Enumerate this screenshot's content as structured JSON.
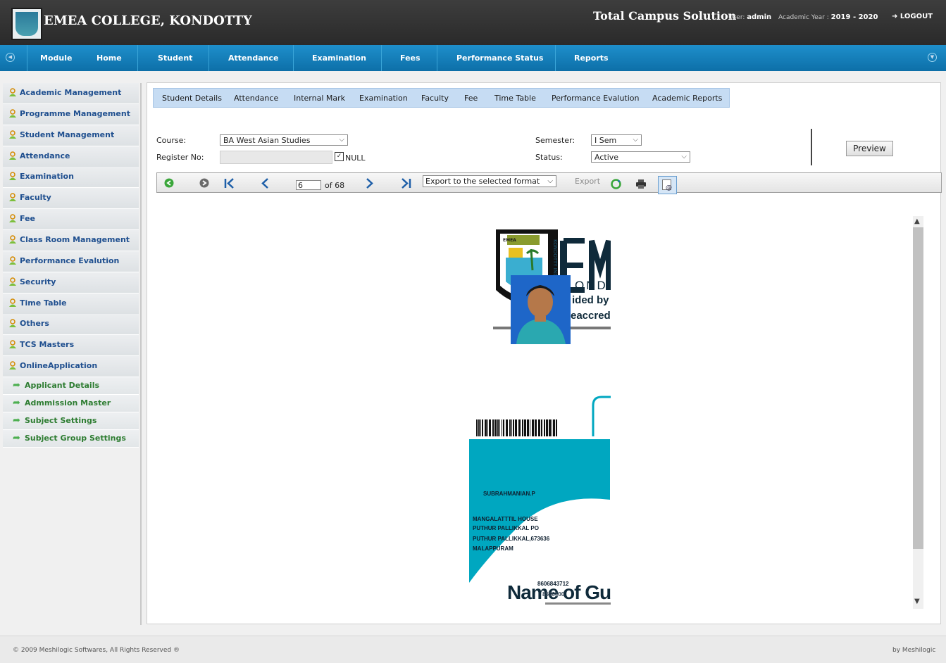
{
  "header": {
    "college_name": "EMEA COLLEGE, KONDOTTY",
    "product_name": "Total Campus Solution",
    "user_label": "User:",
    "user_value": "admin",
    "year_label": "Academic Year :",
    "year_value": "2019 - 2020",
    "logout_label": "LOGOUT"
  },
  "nav": {
    "items": [
      "Module",
      "Home",
      "Student",
      "Attendance",
      "Examination",
      "Fees",
      "Performance Status",
      "Reports"
    ]
  },
  "sidebar": {
    "items": [
      "Academic Management",
      "Programme Management",
      "Student Management",
      "Attendance",
      "Examination",
      "Faculty",
      "Fee",
      "Class Room Management",
      "Performance Evalution",
      "Security",
      "Time Table",
      "Others",
      "TCS Masters",
      "OnlineApplication"
    ],
    "subitems": [
      "Applicant Details",
      "Admmission Master",
      "Subject Settings",
      "Subject Group Settings"
    ]
  },
  "tabs": [
    "Student Details",
    "Attendance",
    "Internal Mark",
    "Examination",
    "Faculty",
    "Fee",
    "Time Table",
    "Performance Evalution",
    "Academic Reports"
  ],
  "filters": {
    "course_label": "Course:",
    "course_value": "BA West Asian Studies",
    "register_label": "Register No:",
    "register_value": "",
    "null_label": "NULL",
    "null_checked": true,
    "semester_label": "Semester:",
    "semester_value": "I Sem",
    "status_label": "Status:",
    "status_value": "Active",
    "preview_label": "Preview"
  },
  "toolbar": {
    "page_value": "6",
    "of_pages": "of 68",
    "export_format": "Export to the selected format",
    "export_label": "Export"
  },
  "report": {
    "logo_letters": "EM",
    "logo_line2": "OND",
    "logo_line3": "ided by",
    "logo_line4": "eaccredi",
    "side_text": "KONDOTTY INDIA",
    "badge_text": "EMEA",
    "name": "SUBRAHMANIAN.P",
    "address": [
      "MANGALATTTIL HOUSE",
      "PUTHUR PALLIKKAL PO",
      "PUTHUR PALLIKKAL,673636",
      "MALAPPURAM"
    ],
    "phone": "8606843712",
    "phone2": "8590400",
    "guardian_heading": "Name of Gu"
  },
  "footer": {
    "copyright": "© 2009 Meshilogic Softwares, All Rights Reserved ®",
    "by": "by Meshilogic"
  },
  "colors": {
    "nav_blue": "#1480c0",
    "sidebar_text": "#1f4f8f",
    "sub_text": "#2e7d32",
    "id_teal": "#00a7c0",
    "navy": "#0f2a3a"
  }
}
